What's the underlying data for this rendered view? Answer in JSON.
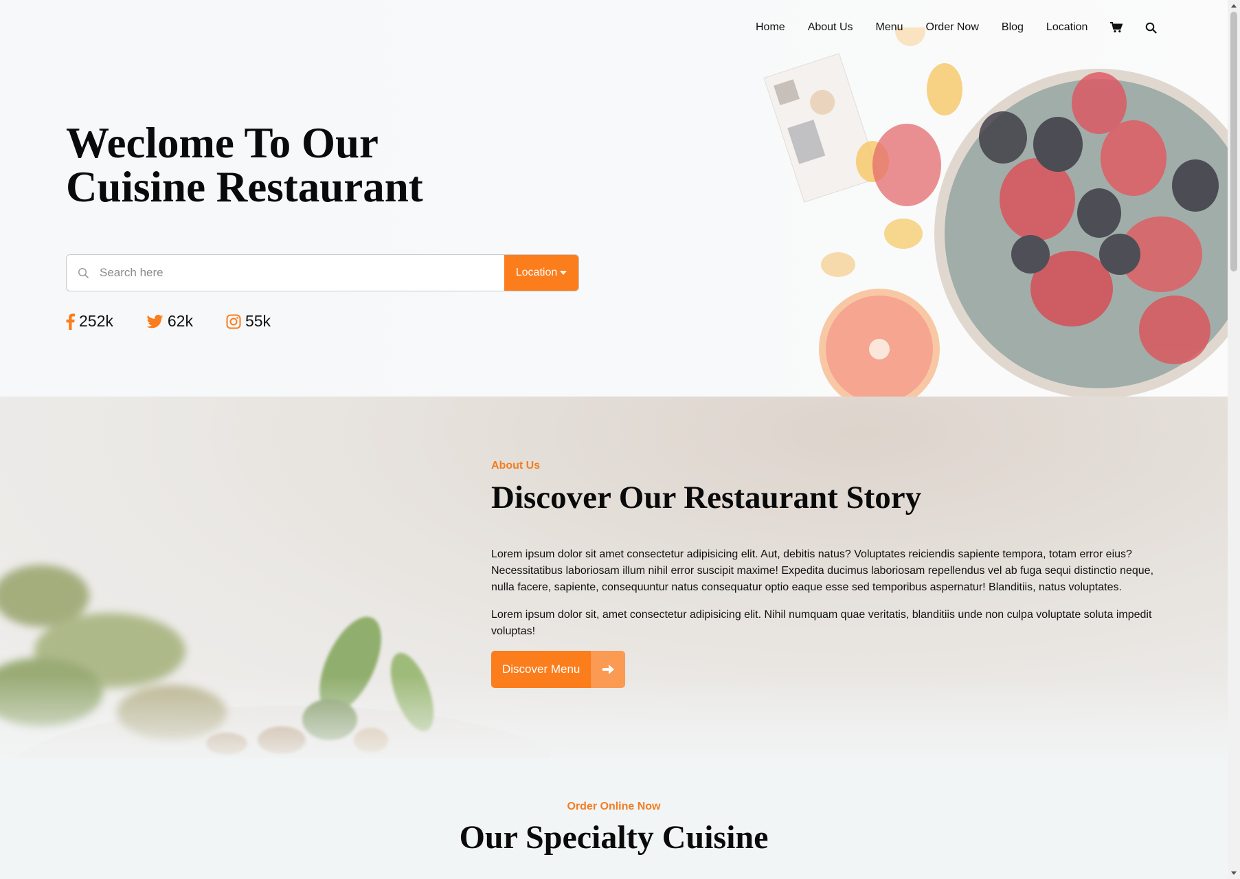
{
  "nav": {
    "items": [
      "Home",
      "About Us",
      "Menu",
      "Order Now",
      "Blog",
      "Location"
    ],
    "cart_icon": "cart-icon",
    "search_icon": "search-icon"
  },
  "hero": {
    "title_line1": "Weclome To Our",
    "title_line2": "Cuisine Restaurant",
    "search_placeholder": "Search here",
    "location_button": "Location",
    "socials": [
      {
        "icon": "facebook-icon",
        "count": "252k"
      },
      {
        "icon": "twitter-icon",
        "count": "62k"
      },
      {
        "icon": "instagram-icon",
        "count": "55k"
      }
    ]
  },
  "about": {
    "eyebrow": "About Us",
    "title": "Discover Our Restaurant Story",
    "paragraph1": "Lorem ipsum dolor sit amet consectetur adipisicing elit. Aut, debitis natus? Voluptates reiciendis sapiente tempora, totam error eius? Necessitatibus laboriosam illum nihil error suscipit maxime! Expedita ducimus laboriosam repellendus vel ab fuga sequi distinctio neque, nulla facere, sapiente, consequuntur natus consequatur optio eaque esse sed temporibus aspernatur! Blanditiis, natus voluptates.",
    "paragraph2": "Lorem ipsum dolor sit, amet consectetur adipisicing elit. Nihil numquam quae veritatis, blanditiis unde non culpa voluptate soluta impedit voluptas!",
    "button": "Discover Menu"
  },
  "specialty": {
    "eyebrow": "Order Online Now",
    "title": "Our Specialty Cuisine"
  },
  "colors": {
    "accent": "#fb7d1c",
    "accent_light": "#fb9a52",
    "eyebrow": "#f27d22"
  }
}
